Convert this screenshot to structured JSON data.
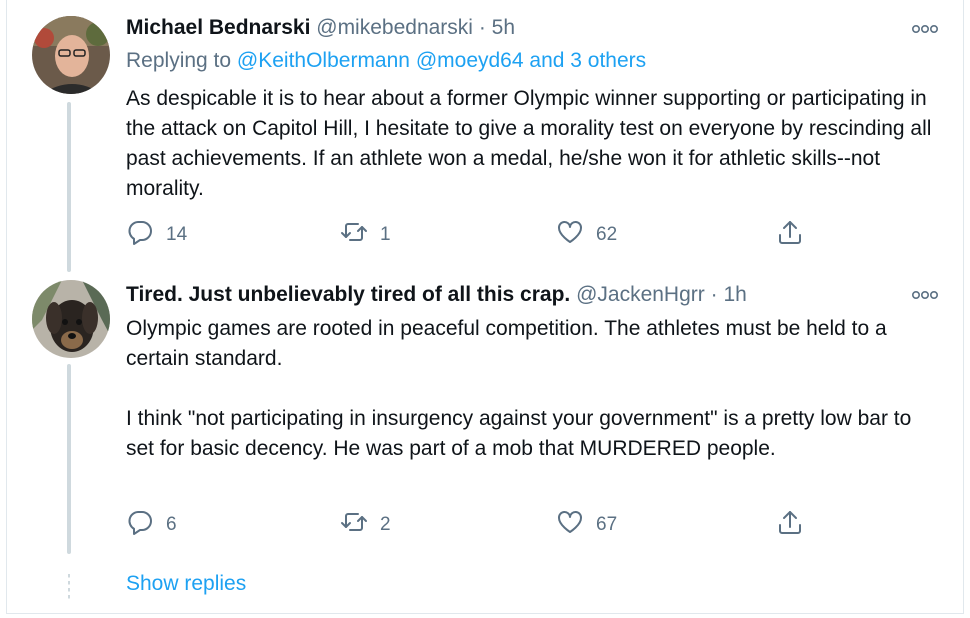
{
  "tweets": [
    {
      "display_name": "Michael Bednarski",
      "handle": "@mikebednarski",
      "separator": "·",
      "time": "5h",
      "replying_prefix": "Replying to",
      "replying_to_1": "@KeithOlbermann",
      "replying_to_2": "@moeyd64",
      "replying_others": "and 3 others",
      "text": "As despicable it is to hear about a former Olympic winner supporting or participating in the attack on Capitol Hill, I hesitate to give a morality test on everyone by rescinding all past achievements. If an athlete won a medal, he/she won it for athletic skills--not morality.",
      "replies": "14",
      "retweets": "1",
      "likes": "62"
    },
    {
      "display_name": "Tired. Just unbelievably tired of all this crap.",
      "handle": "@JackenHgrr",
      "separator": "·",
      "time": "1h",
      "text_p1": "Olympic games are rooted in peaceful competition. The athletes must be held to a certain standard.",
      "text_p2": "I think \"not participating in insurgency against your government\" is a pretty low bar to set for basic decency. He was part of a mob that MURDERED people.",
      "replies": "6",
      "retweets": "2",
      "likes": "67"
    }
  ],
  "show_replies": "Show replies",
  "colors": {
    "link": "#1da1f2",
    "secondary": "#5b7083",
    "thread_line": "#cfd9de"
  },
  "icons": [
    "reply-icon",
    "retweet-icon",
    "like-icon",
    "share-icon",
    "more-icon"
  ]
}
